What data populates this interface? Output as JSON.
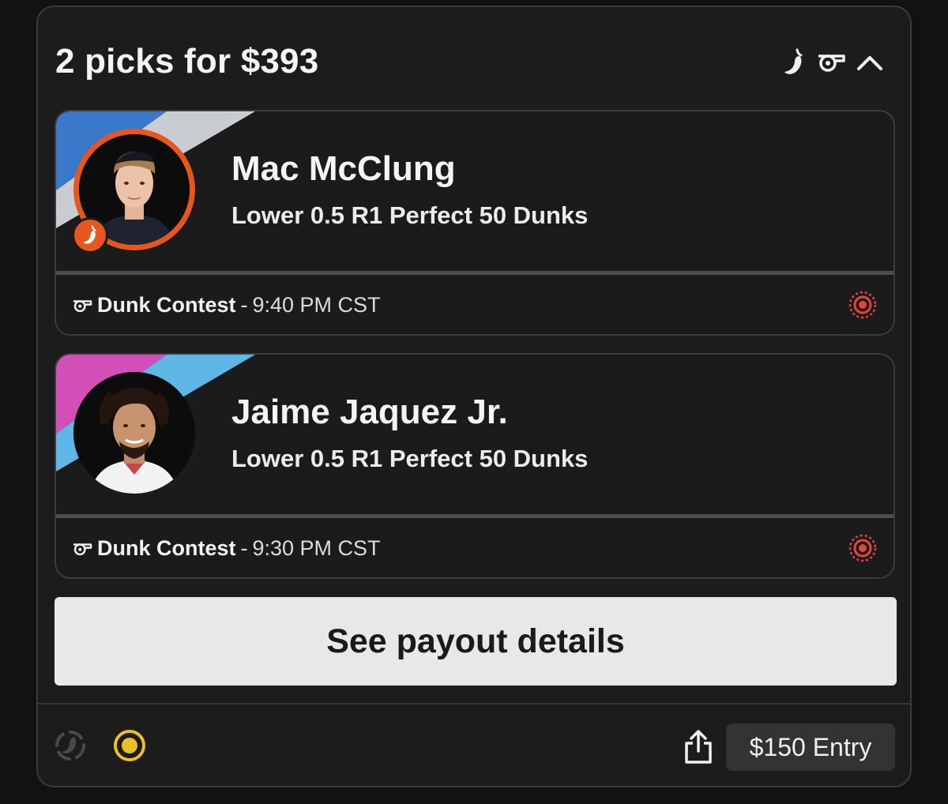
{
  "header": {
    "title": "2 picks for $393",
    "icons": [
      "spicy-pepper-icon",
      "whistle-icon",
      "chevron-up-icon"
    ]
  },
  "picks": [
    {
      "player": "Mac McClung",
      "line": "Lower 0.5 R1 Perfect 50 Dunks",
      "event": "Dunk Contest",
      "separator": "-",
      "time": "9:40 PM CST",
      "stripe_colors": [
        "#3a78c9",
        "#c9ccd0"
      ],
      "spicy": true
    },
    {
      "player": "Jaime Jaquez Jr.",
      "line": "Lower 0.5 R1 Perfect 50 Dunks",
      "event": "Dunk Contest",
      "separator": "-",
      "time": "9:30 PM CST",
      "stripe_colors": [
        "#d14fb7",
        "#5fb7e6"
      ],
      "spicy": false
    }
  ],
  "payout_button": "See payout details",
  "footer": {
    "entry_label": "$150 Entry"
  },
  "colors": {
    "accent_orange": "#e5571f",
    "live_red": "#e5463c",
    "status_yellow": "#e8c02b"
  }
}
